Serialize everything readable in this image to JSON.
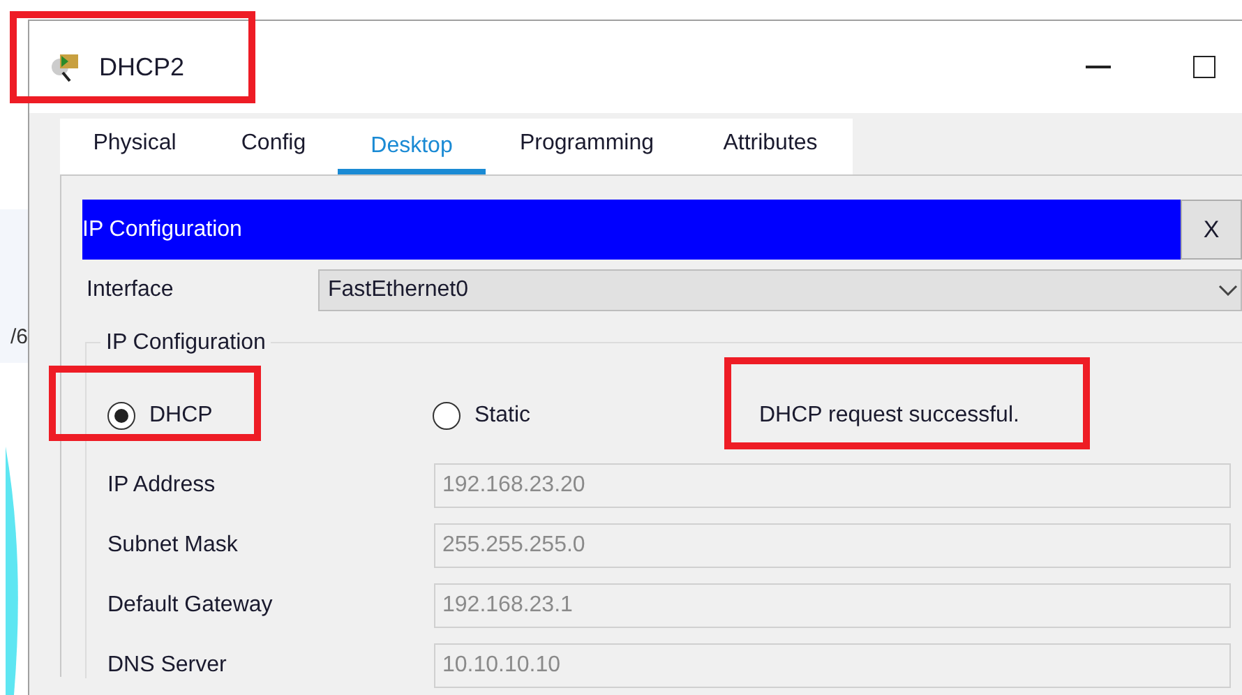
{
  "background_text": "/6",
  "window": {
    "title": "DHCP2"
  },
  "tabs": [
    {
      "label": "Physical",
      "selected": false
    },
    {
      "label": "Config",
      "selected": false
    },
    {
      "label": "Desktop",
      "selected": true
    },
    {
      "label": "Programming",
      "selected": false
    },
    {
      "label": "Attributes",
      "selected": false
    }
  ],
  "panel": {
    "title": "IP Configuration",
    "close": "X"
  },
  "interface": {
    "label": "Interface",
    "value": "FastEthernet0"
  },
  "ip_configuration": {
    "legend": "IP Configuration",
    "modes": [
      {
        "label": "DHCP",
        "selected": true
      },
      {
        "label": "Static",
        "selected": false
      }
    ],
    "message": "DHCP request successful.",
    "fields": [
      {
        "label": "IP Address",
        "value": "192.168.23.20",
        "disabled": true
      },
      {
        "label": "Subnet Mask",
        "value": "255.255.255.0",
        "disabled": true
      },
      {
        "label": "Default Gateway",
        "value": "192.168.23.1",
        "disabled": true
      },
      {
        "label": "DNS Server",
        "value": "10.10.10.10",
        "disabled": true
      }
    ]
  }
}
